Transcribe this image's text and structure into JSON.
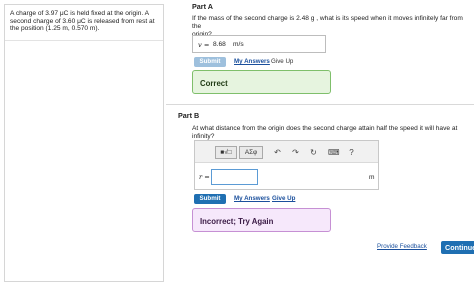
{
  "problem": {
    "text_line1": "A charge of 3.97 μC is held fixed at the origin. A",
    "text_line2": "second charge of 3.60 μC is released from rest at",
    "text_line3": "the position (1.25 m, 0.570 m)."
  },
  "part_a": {
    "title": "Part A",
    "question_line1": "If the mass of the second charge is 2.48 g , what is its speed when it moves infinitely far from the",
    "question_line2": "origin?",
    "var_label": "v =",
    "answer_value": "8.68",
    "answer_unit": "m/s",
    "submit_label": "Submit",
    "my_answers_label": "My Answers",
    "give_up_label": "Give Up",
    "result": "Correct"
  },
  "part_b": {
    "title": "Part B",
    "question": "At what distance from the origin does the second charge attain half the speed it will have at infinity?",
    "var_label": "r =",
    "answer_value": "",
    "answer_unit": "m",
    "toolbar": {
      "templates_label": "■√□",
      "symbols_label": "AΣφ",
      "undo_icon": "↶",
      "redo_icon": "↷",
      "reset_icon": "↻",
      "keyboard_icon": "⌨",
      "help_icon": "?"
    },
    "submit_label": "Submit",
    "my_answers_label": "My Answers",
    "give_up_label": "Give Up",
    "result": "Incorrect; Try Again"
  },
  "footer": {
    "feedback_label": "Provide Feedback",
    "continue_label": "Continue"
  }
}
